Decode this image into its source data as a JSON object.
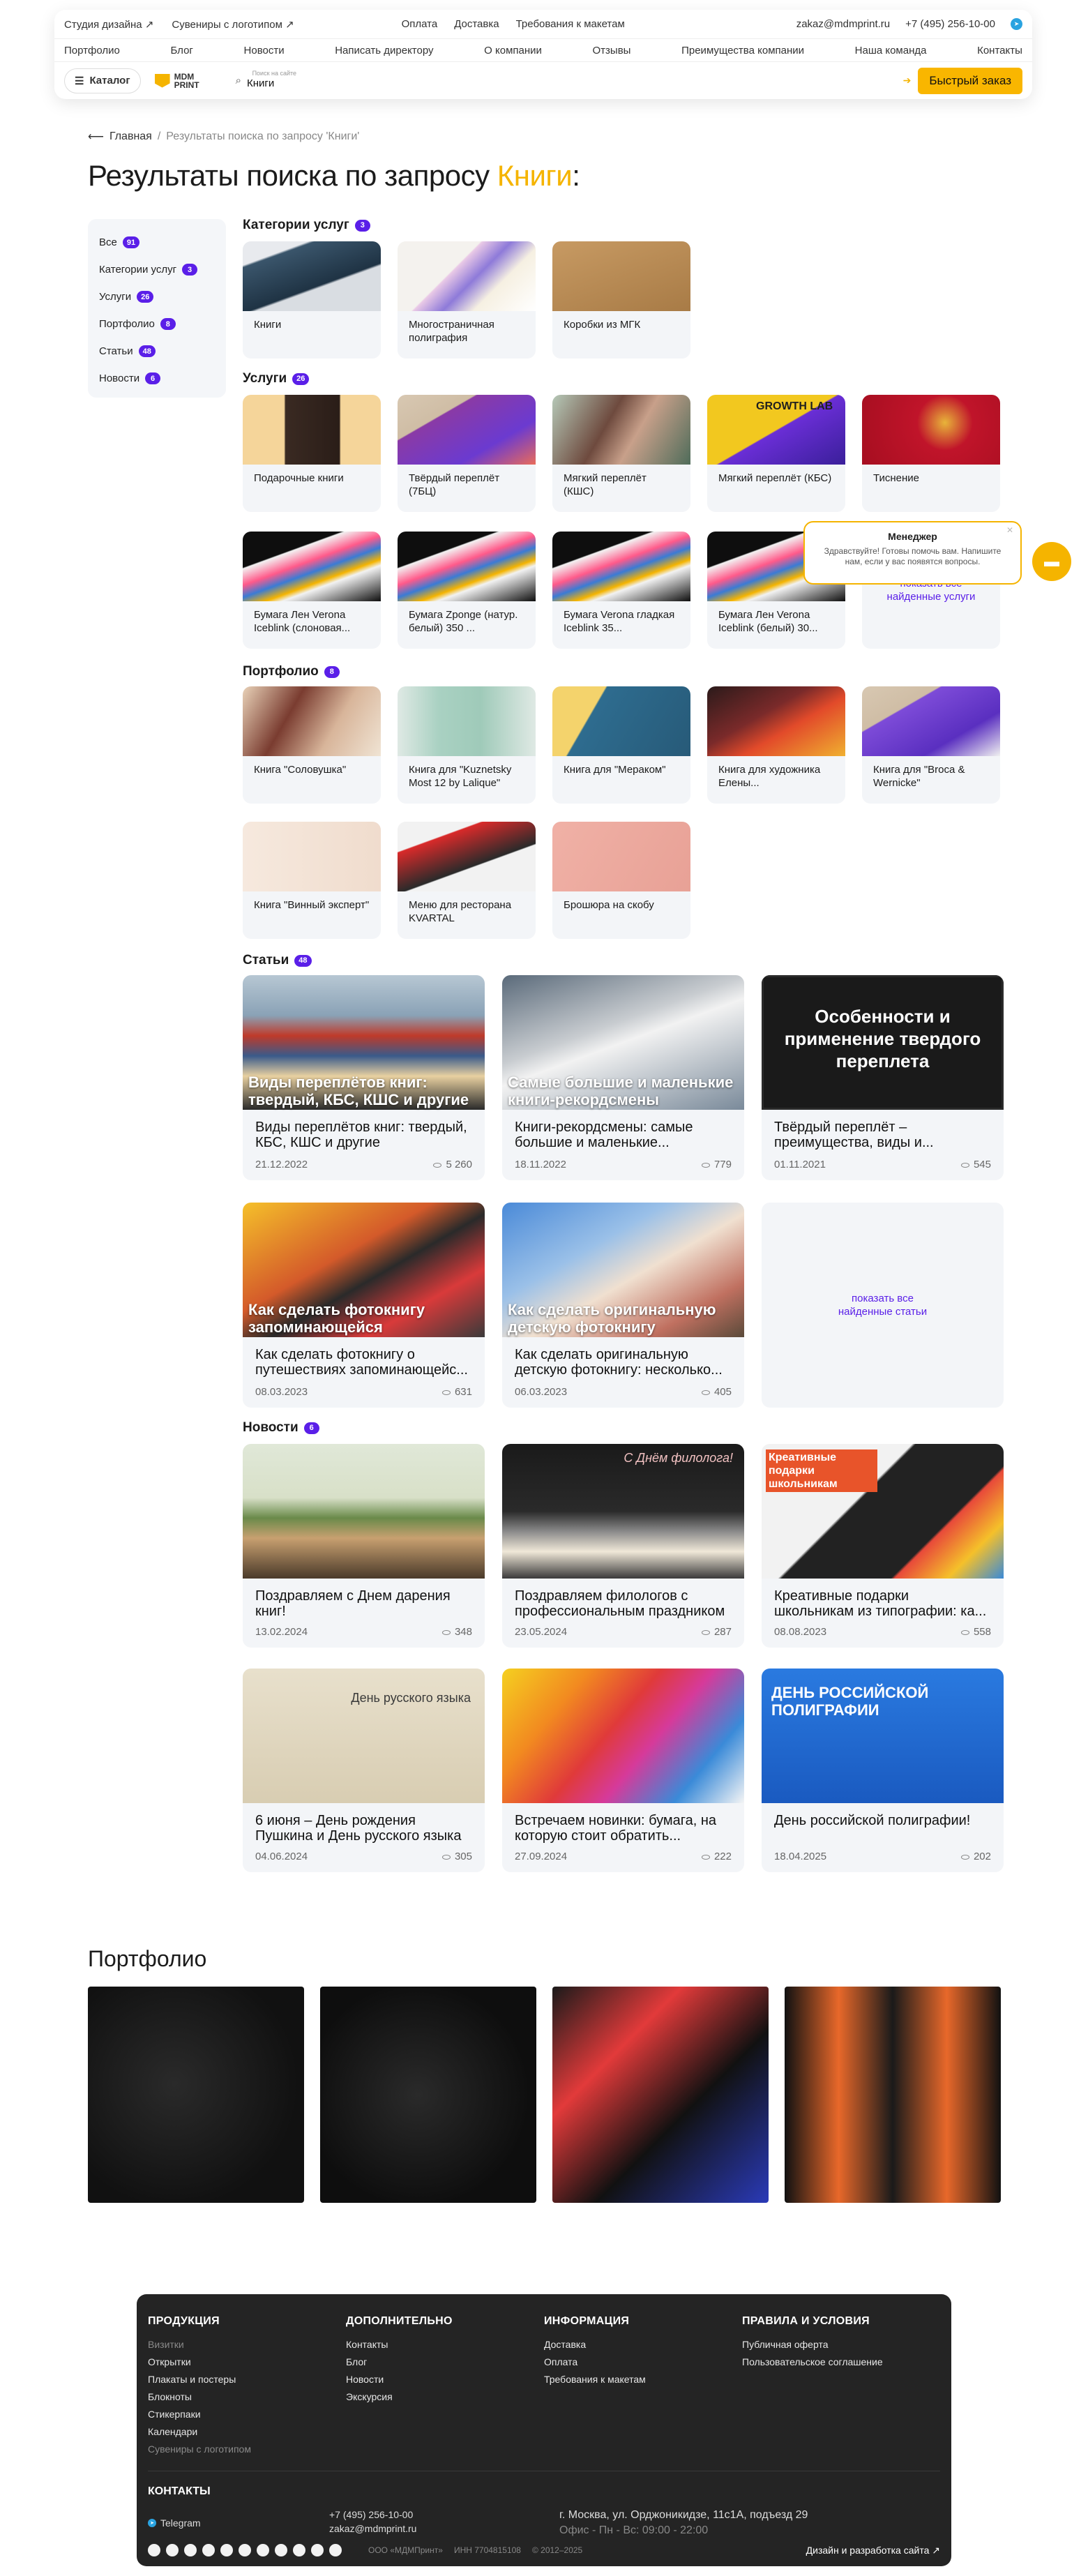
{
  "header": {
    "top_left": [
      "Студия дизайна ↗",
      "Сувениры с логотипом ↗"
    ],
    "top_center": [
      "Оплата",
      "Доставка",
      "Требования к макетам"
    ],
    "email": "zakaz@mdmprint.ru",
    "phone": "+7 (495) 256-10-00",
    "nav": [
      "Портфолио",
      "Блог",
      "Новости",
      "Написать директору",
      "О компании",
      "Отзывы",
      "Преимущества компании",
      "Наша команда",
      "Контакты"
    ],
    "catalog_label": "Каталог",
    "logo_text": "MDM PRINT",
    "search_placeholder": "Поиск на сайте",
    "search_value": "Книги",
    "quick_order": "Быстрый заказ"
  },
  "breadcrumb": {
    "home": "Главная",
    "sep": "/",
    "current": "Результаты поиска по запросу 'Книги'"
  },
  "title": {
    "prefix": "Результаты поиска по запросу ",
    "query": "Книги",
    "suffix": ":"
  },
  "filters": [
    {
      "label": "Все",
      "count": "91"
    },
    {
      "label": "Категории услуг",
      "count": "3"
    },
    {
      "label": "Услуги",
      "count": "26"
    },
    {
      "label": "Портфолио",
      "count": "8"
    },
    {
      "label": "Статьи",
      "count": "48"
    },
    {
      "label": "Новости",
      "count": "6"
    }
  ],
  "sections": {
    "categories": {
      "label": "Категории услуг",
      "count": "3",
      "items": [
        "Книги",
        "Многостраничная полиграфия",
        "Коробки из МГК"
      ]
    },
    "services": {
      "label": "Услуги",
      "count": "26",
      "items": [
        "Подарочные книги",
        "Твёрдый переплёт (7БЦ)",
        "Мягкий переплёт (КШС)",
        "Мягкий переплёт (КБС)",
        "Тиснение",
        "Бумага Лен Verona Iceblink (слоновая...",
        "Бумага Zponge (натур. белый) 350 ...",
        "Бумага Verona гладкая Iceblink 35...",
        "Бумага Лен Verona Iceblink (белый) 30..."
      ],
      "more": "показать все найденные услуги"
    },
    "portfolio": {
      "label": "Портфолио",
      "count": "8",
      "items": [
        "Книга \"Соловушка\"",
        "Книга для \"Kuznetsky Most 12 by Lalique\"",
        "Книга для \"Мераком\"",
        "Книга для художника Елены...",
        "Книга для \"Broca & Wernicke\"",
        "Книга \"Винный эксперт\"",
        "Меню для ресторана KVARTAL",
        "Брошюра на скобу"
      ]
    },
    "articles": {
      "label": "Статьи",
      "count": "48",
      "more": "показать все найденные статьи",
      "items": [
        {
          "overlay": "Виды переплётов книг: твердый, КБС, КШС и другие",
          "title": "Виды переплётов книг: твердый, КБС, КШС и другие",
          "date": "21.12.2022",
          "views": "5 260"
        },
        {
          "overlay": "Самые большие и маленькие книги-рекордсмены",
          "title": "Книги-рекордсмены: самые большие и маленькие...",
          "date": "18.11.2022",
          "views": "779"
        },
        {
          "overlay": "Особенности и применение твердого переплета",
          "title": "Твёрдый переплёт – преимущества, виды и...",
          "date": "01.11.2021",
          "views": "545"
        },
        {
          "overlay": "Как сделать фотокнигу запоминающейся",
          "title": "Как сделать фотокнигу о путешествиях запоминающейс...",
          "date": "08.03.2023",
          "views": "631"
        },
        {
          "overlay": "Как сделать оригинальную детскую фотокнигу",
          "title": "Как сделать оригинальную детскую фотокнигу: несколько...",
          "date": "06.03.2023",
          "views": "405"
        }
      ]
    },
    "news": {
      "label": "Новости",
      "count": "6",
      "items": [
        {
          "title": "Поздравляем с Днем дарения книг!",
          "date": "13.02.2024",
          "views": "348"
        },
        {
          "title": "Поздравляем филологов с профессиональным праздником",
          "date": "23.05.2024",
          "views": "287"
        },
        {
          "title": "Креативные подарки школьникам из типографии: ка...",
          "date": "08.08.2023",
          "views": "558"
        },
        {
          "title": "6 июня – День рождения Пушкина и День русского языка",
          "date": "04.06.2024",
          "views": "305"
        },
        {
          "title": "Встречаем новинки: бумага, на которую стоит обратить...",
          "date": "27.09.2024",
          "views": "222"
        },
        {
          "title": "День российской полиграфии!",
          "date": "18.04.2025",
          "views": "202"
        }
      ]
    }
  },
  "image_text": {
    "news1_overlay": "Креативные подарки школьникам",
    "news2_overlay": "С Днём филолога!",
    "news3_overlay": "День русского языка",
    "news5_overlay": "ДЕНЬ РОССИЙСКОЙ ПОЛИГРАФИИ",
    "service_growth": "GROWTH LAB"
  },
  "portfolio_block": {
    "title": "Портфолио"
  },
  "chat": {
    "title": "Менеджер",
    "text": "Здравствуйте! Готовы помочь вам. Напишите нам, если у вас появятся вопросы."
  },
  "footer": {
    "columns": [
      {
        "title": "ПРОДУКЦИЯ",
        "items": [
          "Визитки",
          "Открытки",
          "Плакаты и постеры",
          "Блокноты",
          "Стикерпаки",
          "Календари",
          "Сувениры с логотипом"
        ]
      },
      {
        "title": "ДОПОЛНИТЕЛЬНО",
        "items": [
          "Контакты",
          "Блог",
          "Новости",
          "Экскурсия"
        ]
      },
      {
        "title": "ИНФОРМАЦИЯ",
        "items": [
          "Доставка",
          "Оплата",
          "Требования к макетам"
        ]
      },
      {
        "title": "ПРАВИЛА И УСЛОВИЯ",
        "items": [
          "Публичная оферта",
          "Пользовательское соглашение"
        ]
      }
    ],
    "contacts_title": "КОНТАКТЫ",
    "telegram": "Telegram",
    "phone": "+7 (495) 256-10-00",
    "email": "zakaz@mdmprint.ru",
    "address": "г. Москва, ул. Орджоникидзе, 11с1А, подъезд 29",
    "hours": "Офис - Пн - Вс: 09:00 - 22:00",
    "company": "ООО «МДМПринт»",
    "inn": "ИНН 7704815108",
    "years": "© 2012–2025",
    "dev": "Дизайн и разработка сайта ↗"
  },
  "colors": {
    "accent": "#f5b400",
    "badge": "#5a1fe8",
    "footer_bg": "#242424"
  }
}
